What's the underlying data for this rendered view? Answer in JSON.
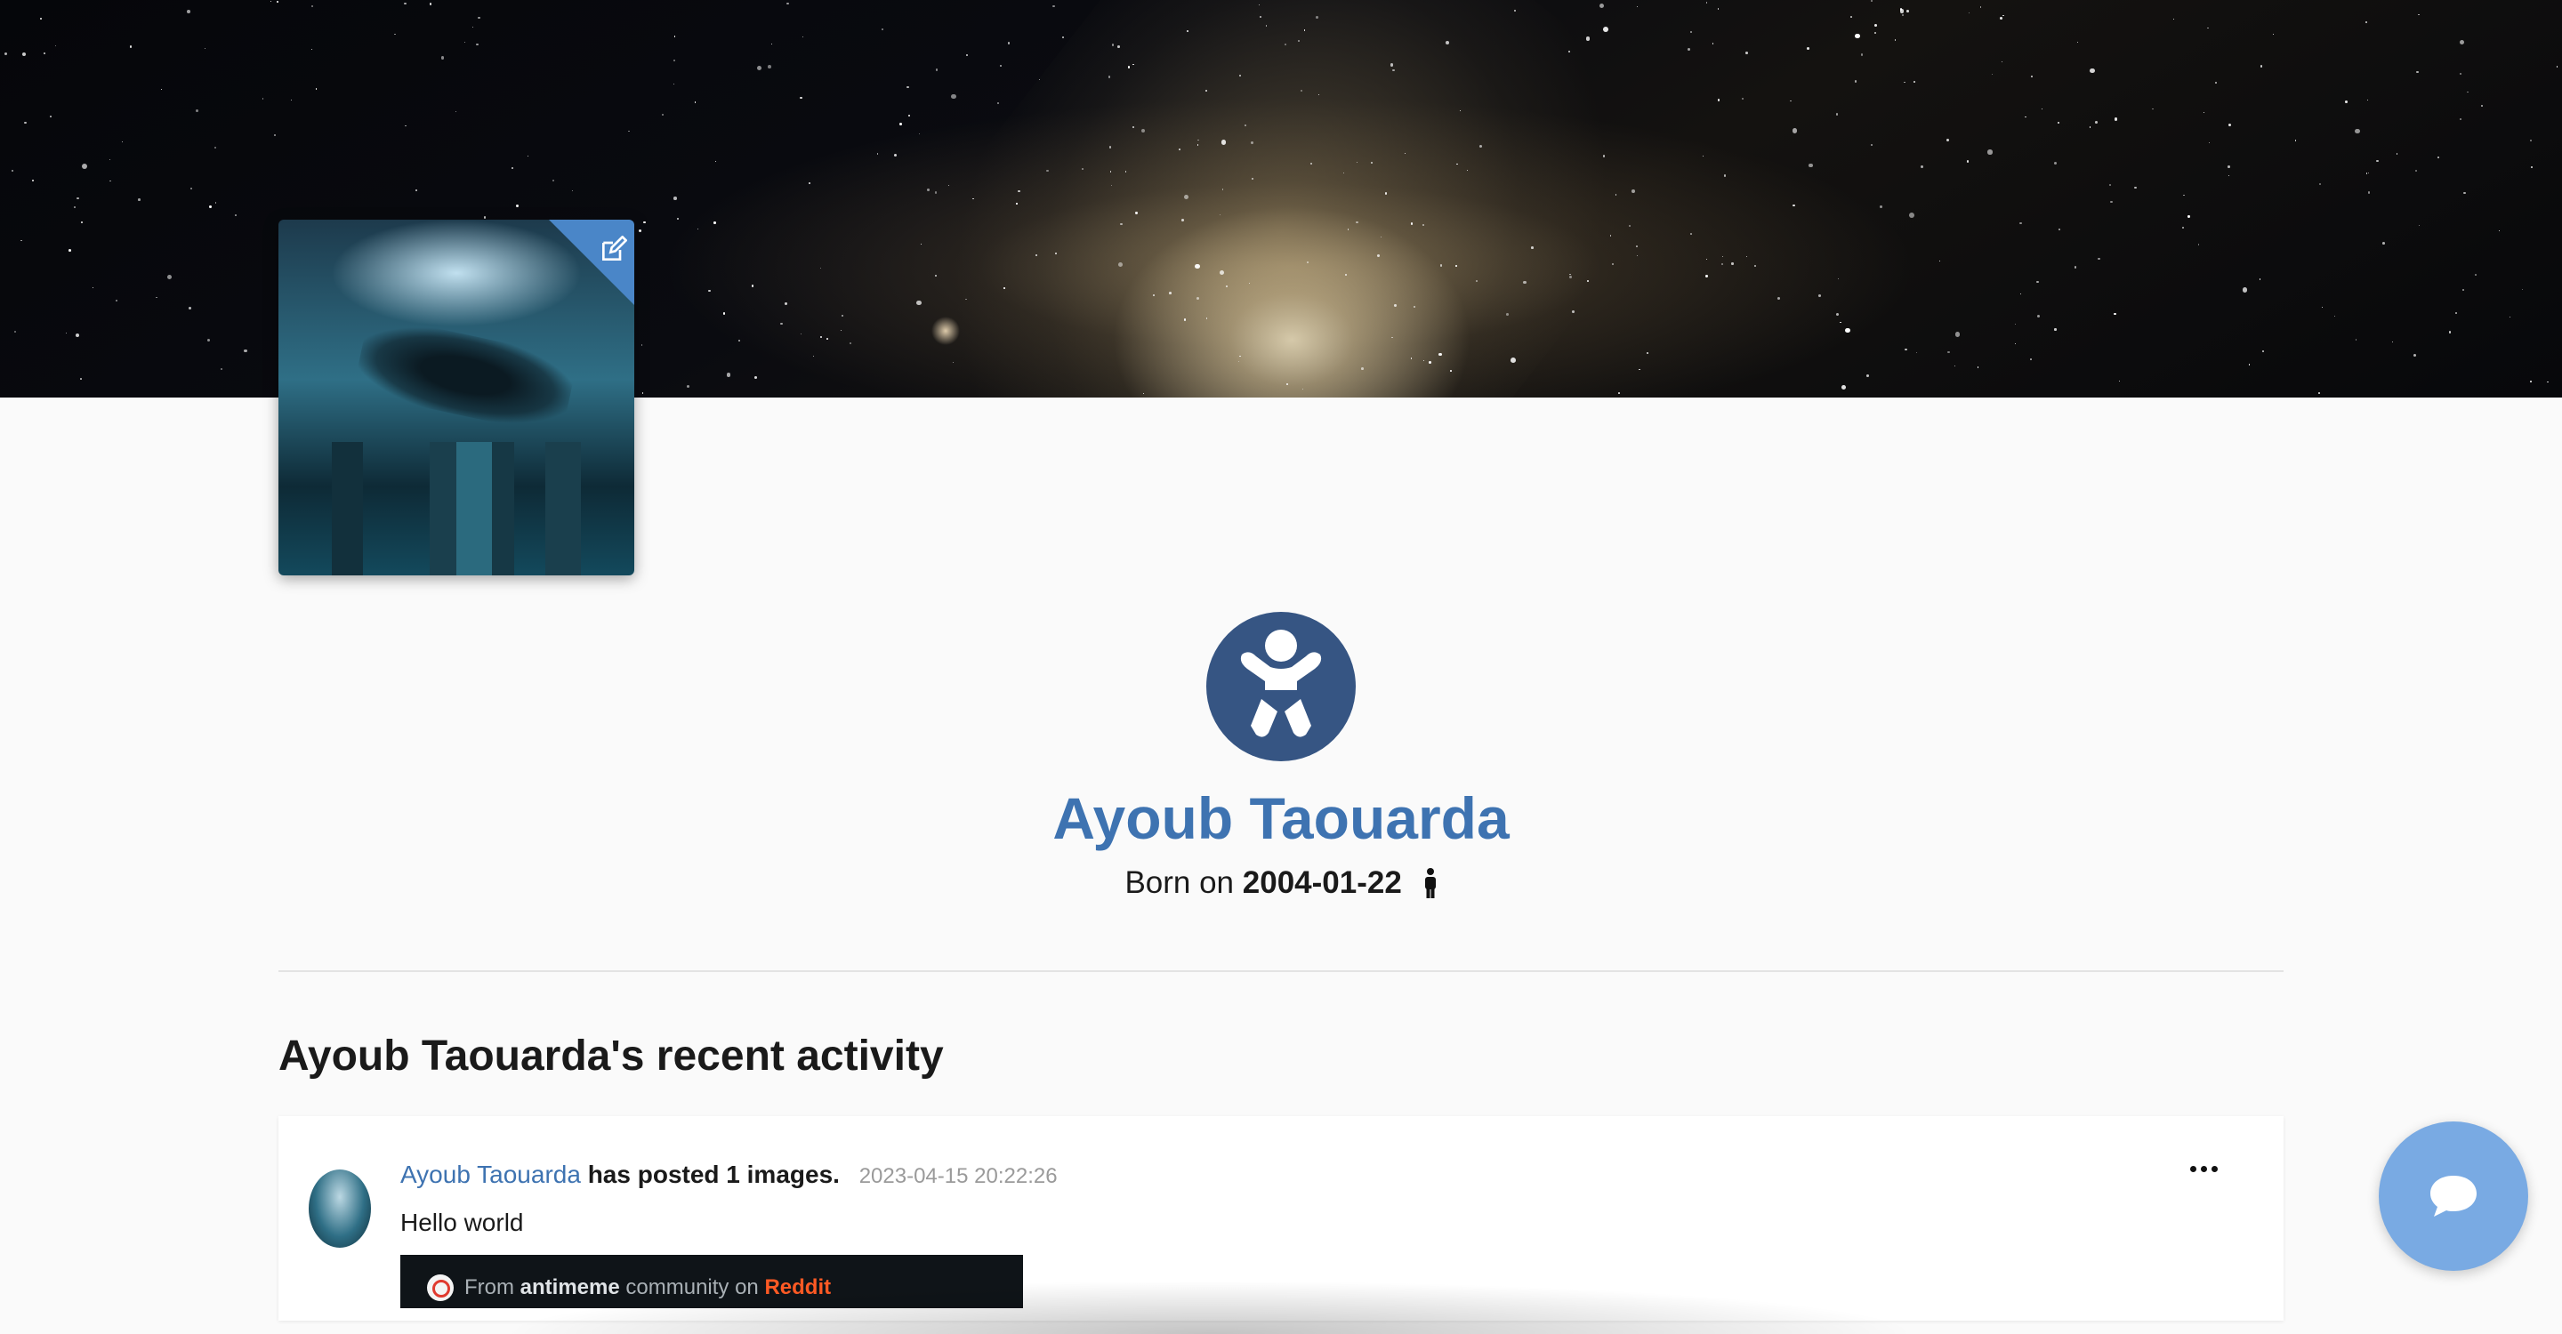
{
  "profile": {
    "name": "Ayoub Taouarda",
    "born_prefix": "Born on",
    "birth_date": "2004-01-22",
    "gender_icon": "male-person-icon",
    "badge_icon": "baby-icon",
    "edit_icon": "edit-icon"
  },
  "activity": {
    "title": "Ayoub Taouarda's recent activity",
    "posts": [
      {
        "author": "Ayoub Taouarda",
        "action": "has posted 1 images.",
        "timestamp": "2023-04-15 20:22:26",
        "text": "Hello world",
        "more_icon": "more-horizontal-icon",
        "embed": {
          "from": "From",
          "community": "antimeme",
          "community_on": "community on",
          "platform": "Reddit"
        }
      }
    ]
  },
  "chat": {
    "icon": "chat-bubble-icon"
  },
  "colors": {
    "accent": "#3e73b1",
    "badge": "#365583",
    "chat_fab": "#79aae3",
    "edit_corner": "#4a86c8",
    "reddit": "#ff5a24"
  }
}
